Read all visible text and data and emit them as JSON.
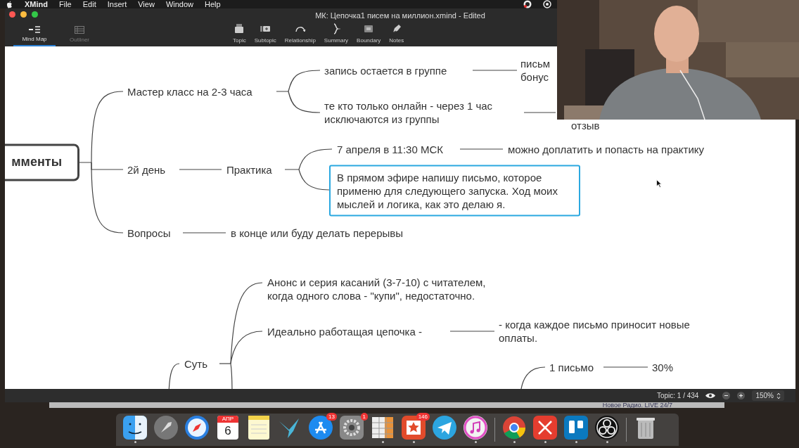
{
  "menu_bar": {
    "app": "XMind",
    "items": [
      "File",
      "Edit",
      "Insert",
      "View",
      "Window",
      "Help"
    ]
  },
  "window": {
    "title": "МК: Цепочка1 писем на миллион.xmind - Edited",
    "view_tabs": [
      {
        "label": "Mind Map",
        "selected": true
      },
      {
        "label": "Outliner",
        "selected": false
      }
    ],
    "tools": [
      "Topic",
      "Subtopic",
      "Relationship",
      "Summary",
      "Boundary",
      "Notes"
    ]
  },
  "mind_map": {
    "topics": [
      {
        "text": "мменты",
        "kind": "central",
        "selected": false
      },
      {
        "text": "Мастер класс на 2-3 часа",
        "kind": "topic",
        "selected": false
      },
      {
        "text": "запись остается в группе",
        "kind": "topic",
        "selected": false
      },
      {
        "text": "письм\nбонус",
        "kind": "topic",
        "selected": false
      },
      {
        "text": "те кто только онлайн - через 1 час\nисключаются из группы",
        "kind": "topic",
        "selected": false
      },
      {
        "text": "отзыв",
        "kind": "topic",
        "selected": false
      },
      {
        "text": "2й день",
        "kind": "topic",
        "selected": false
      },
      {
        "text": "Практика",
        "kind": "topic",
        "selected": false
      },
      {
        "text": "7 апреля в 11:30 МСК",
        "kind": "topic",
        "selected": false
      },
      {
        "text": "можно доплатить и попасть на практику",
        "kind": "topic",
        "selected": false
      },
      {
        "text": "В прямом эфире напишу письмо, которое применю для следующего запуска. Ход моих мыслей и логика, как это делаю я.",
        "kind": "topic",
        "selected": true
      },
      {
        "text": "Вопросы",
        "kind": "topic",
        "selected": false
      },
      {
        "text": "в конце или буду делать перерывы",
        "kind": "topic",
        "selected": false
      },
      {
        "text": "Анонс и серия касаний (3-7-10) с читателем,\nкогда одного слова - \"купи\", недостаточно.",
        "kind": "topic",
        "selected": false
      },
      {
        "text": "Идеально работащая цепочка -",
        "kind": "topic",
        "selected": false
      },
      {
        "text": "- когда каждое письмо приносит новые\nоплаты.",
        "kind": "topic",
        "selected": false
      },
      {
        "text": "Суть",
        "kind": "topic",
        "selected": false
      },
      {
        "text": "1 письмо",
        "kind": "topic",
        "selected": false
      },
      {
        "text": "30%",
        "kind": "topic",
        "selected": false
      }
    ]
  },
  "status_bar": {
    "topic_count": "Topic: 1 / 434",
    "zoom": "150%"
  },
  "background_window": {
    "text": "Новое Радио. LIVE 24/7"
  },
  "dock": {
    "items": [
      {
        "kind": "finder",
        "running": true
      },
      {
        "kind": "rocket",
        "running": false
      },
      {
        "kind": "compass",
        "running": false
      },
      {
        "kind": "calendar",
        "month": "АПР",
        "day": "6",
        "running": false
      },
      {
        "kind": "notepad",
        "running": false
      },
      {
        "kind": "bird",
        "running": false
      },
      {
        "kind": "appstore",
        "badge": "13",
        "running": false
      },
      {
        "kind": "gear",
        "badge": "1",
        "running": false
      },
      {
        "kind": "spreadsheet",
        "running": true
      },
      {
        "kind": "star",
        "badge": "146",
        "running": true
      },
      {
        "kind": "plane",
        "running": false
      },
      {
        "kind": "music",
        "running": true
      },
      {
        "kind": "separator"
      },
      {
        "kind": "chrome",
        "running": true
      },
      {
        "kind": "xmark",
        "running": true
      },
      {
        "kind": "trello",
        "running": true
      },
      {
        "kind": "obs",
        "running": true
      },
      {
        "kind": "separator"
      },
      {
        "kind": "trash",
        "running": false
      }
    ]
  }
}
